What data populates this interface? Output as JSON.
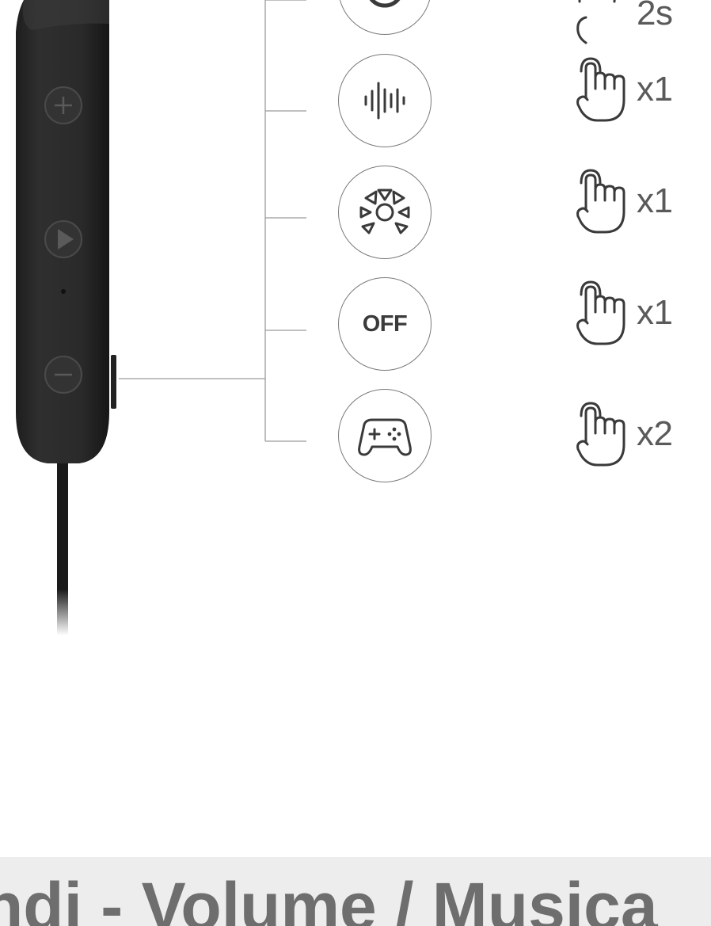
{
  "modes": [
    {
      "icon": "power-icon",
      "tap_label": "2s"
    },
    {
      "icon": "sound-wave-icon",
      "tap_label": "x1"
    },
    {
      "icon": "surround-sound-icon",
      "tap_label": "x1"
    },
    {
      "icon": "off-icon",
      "icon_text": "OFF",
      "tap_label": "x1"
    },
    {
      "icon": "gamepad-icon",
      "tap_label": "x2"
    }
  ],
  "remote": {
    "buttons": [
      "volume-up-icon",
      "play-icon",
      "volume-down-icon"
    ]
  },
  "footer": {
    "text": "ndi - Volume / Musica"
  },
  "colors": {
    "device": "#2b2b2b",
    "line": "#9a9a9a",
    "footer_bg": "#ededed",
    "footer_text": "#6e6e6e"
  }
}
